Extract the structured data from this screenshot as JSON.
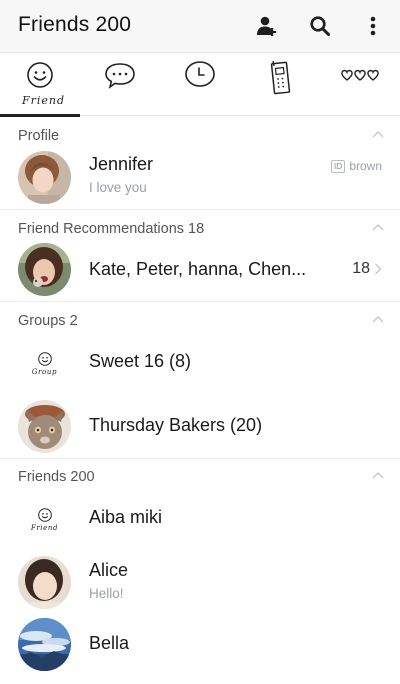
{
  "header": {
    "title": "Friends 200"
  },
  "tabs": [
    {
      "id": "friend",
      "label": "Friend"
    },
    {
      "id": "chats"
    },
    {
      "id": "timeline"
    },
    {
      "id": "calls"
    },
    {
      "id": "more"
    }
  ],
  "sections": {
    "profile": {
      "title": "Profile",
      "user": {
        "name": "Jennifer",
        "status": "I love you",
        "id_badge": "ID",
        "id_value": "brown"
      }
    },
    "recommendations": {
      "title": "Friend Recommendations 18",
      "row": {
        "name": "Kate, Peter, hanna, Chen...",
        "count": "18"
      }
    },
    "groups": {
      "title": "Groups 2",
      "items": [
        {
          "name": "Sweet 16 (8)",
          "icon_label": "Group"
        },
        {
          "name": "Thursday Bakers (20)"
        }
      ]
    },
    "friends": {
      "title": "Friends 200",
      "items": [
        {
          "name": "Aiba miki",
          "icon_label": "Friend"
        },
        {
          "name": "Alice",
          "status": "Hello!"
        },
        {
          "name": "Bella"
        }
      ]
    }
  },
  "colors": {
    "header_bg": "#f7f7f7",
    "text_primary": "#1a1a1a",
    "text_secondary": "#9aa0a6",
    "divider": "#ececec"
  }
}
